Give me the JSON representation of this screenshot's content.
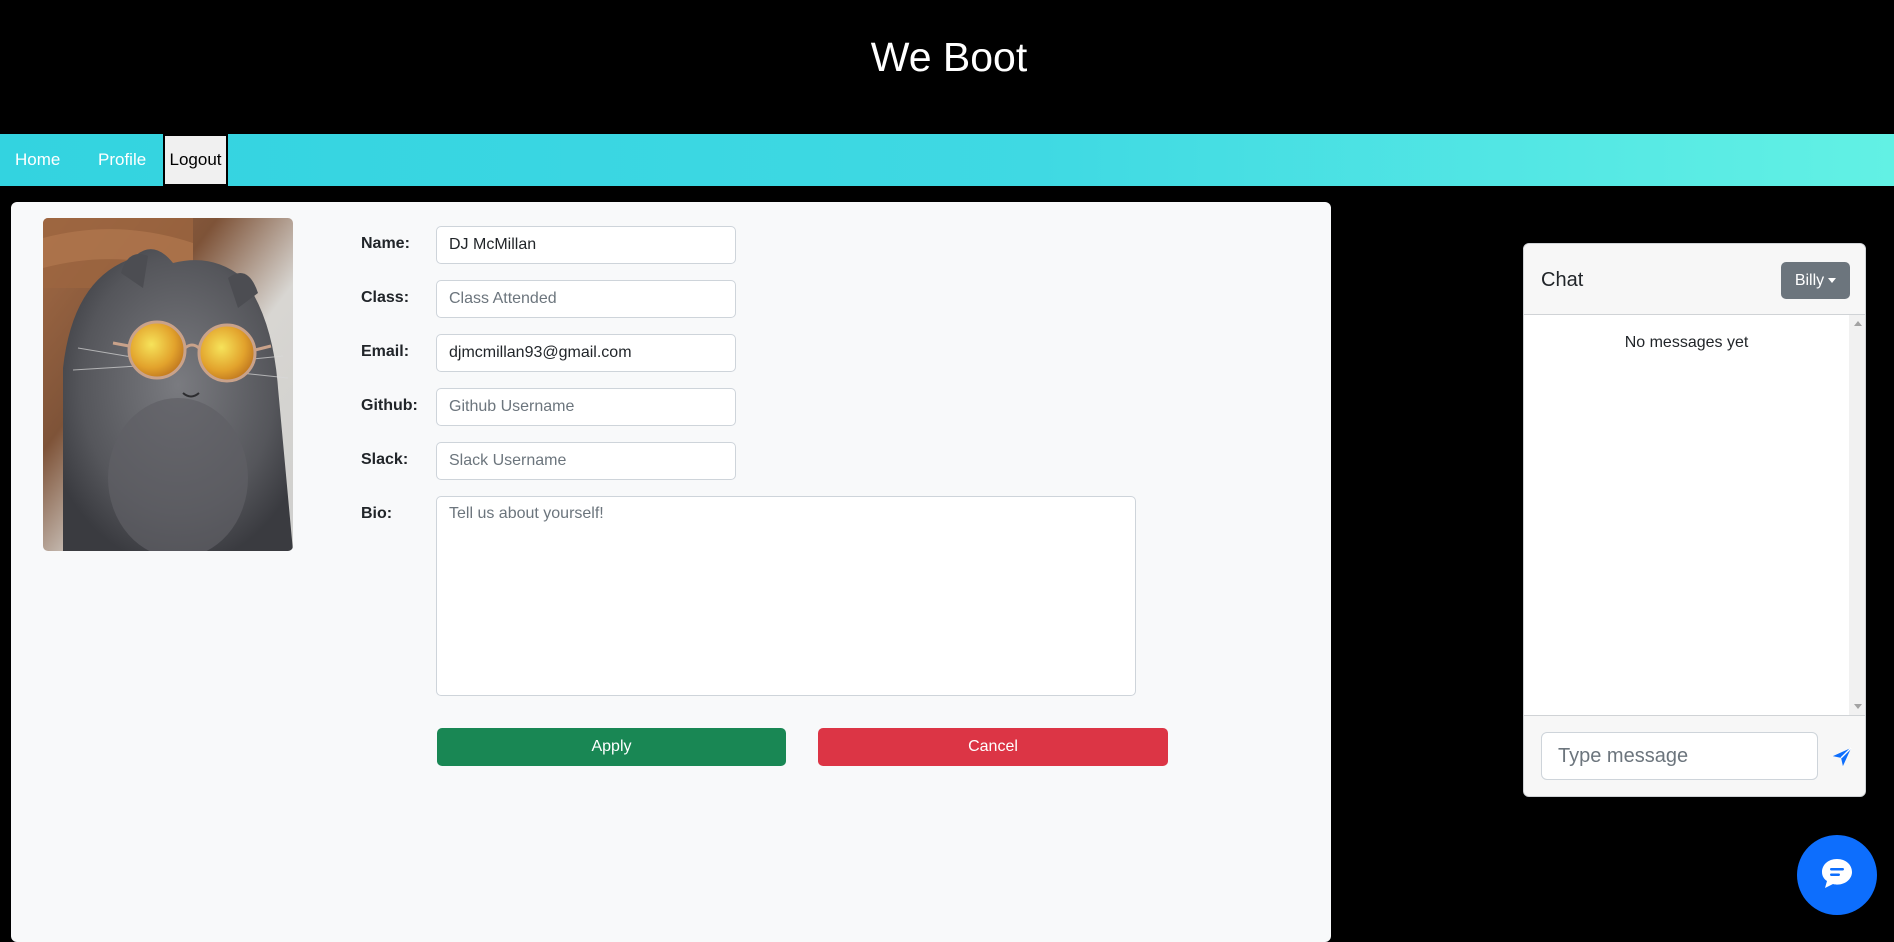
{
  "header": {
    "title": "We Boot"
  },
  "nav": {
    "home": "Home",
    "profile": "Profile",
    "logout": "Logout"
  },
  "profile": {
    "fields": {
      "name": {
        "label": "Name:",
        "value": "DJ McMillan",
        "placeholder": ""
      },
      "class": {
        "label": "Class:",
        "value": "",
        "placeholder": "Class Attended"
      },
      "email": {
        "label": "Email:",
        "value": "djmcmillan93@gmail.com",
        "placeholder": ""
      },
      "github": {
        "label": "Github:",
        "value": "",
        "placeholder": "Github Username"
      },
      "slack": {
        "label": "Slack:",
        "value": "",
        "placeholder": "Slack Username"
      },
      "bio": {
        "label": "Bio:",
        "value": "",
        "placeholder": "Tell us about yourself!"
      }
    },
    "apply_label": "Apply",
    "cancel_label": "Cancel"
  },
  "chat": {
    "title": "Chat",
    "user": "Billy",
    "empty_text": "No messages yet",
    "input_placeholder": "Type message"
  },
  "colors": {
    "apply": "#198754",
    "cancel": "#dc3545",
    "fab": "#0d6efd",
    "nav_gradient_start": "#33d3e0",
    "nav_gradient_end": "#62f1e4"
  },
  "icons": {
    "send": "send-icon",
    "chat_fab": "chat-bubble-icon",
    "avatar": "cat-with-sunglasses-photo"
  }
}
